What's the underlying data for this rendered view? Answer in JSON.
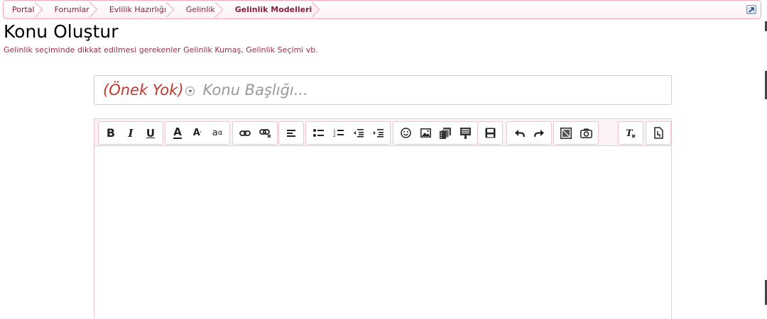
{
  "breadcrumb": {
    "items": [
      "Portal",
      "Forumlar",
      "Evlilik Hazırlığı",
      "Gelinlik",
      "Gelinlik Modelleri"
    ]
  },
  "header": {
    "title": "Konu Oluştur",
    "description": "Gelinlik seçiminde dikkat edilmesi gerekenler Gelinlik Kumaş, Gelinlik Seçimi vb."
  },
  "form": {
    "prefix_label": "(Önek Yok)",
    "title_placeholder": "Konu Başlığı..."
  },
  "toolbar": {
    "bold": "B",
    "italic": "I",
    "underline": "U",
    "font_color": "A",
    "font_size": "A",
    "font_family": "a",
    "icons": [
      "bold-icon",
      "italic-icon",
      "underline-icon",
      "font-color-icon",
      "font-size-icon",
      "font-family-icon",
      "link-icon",
      "unlink-icon",
      "align-left-icon",
      "bulleted-list-icon",
      "numbered-list-icon",
      "outdent-icon",
      "indent-icon",
      "smilie-icon",
      "image-icon",
      "media-icon",
      "quote-icon",
      "save-draft-icon",
      "undo-icon",
      "redo-icon",
      "embed-icon",
      "screenshot-icon",
      "remove-format-icon",
      "bbcode-toggle-icon"
    ]
  },
  "colors": {
    "accent": "#8a1f3d",
    "border": "#f2c4cf",
    "prefix": "#c0392b"
  }
}
